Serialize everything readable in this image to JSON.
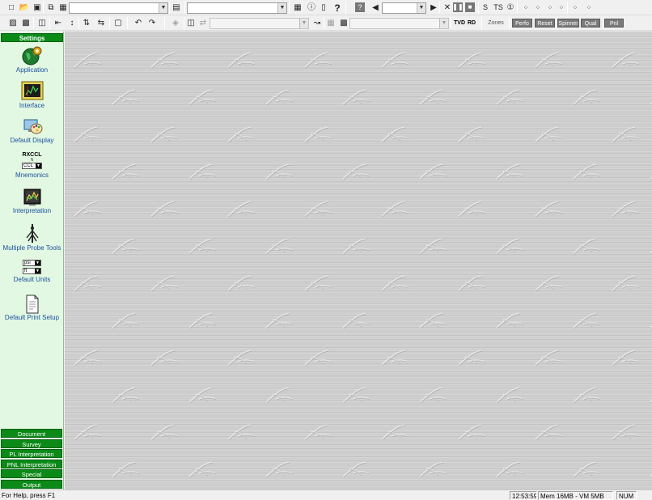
{
  "toolbar1": {
    "icons": [
      "new-file-icon",
      "open-folder-icon",
      "save-icon",
      "copy-icon",
      "paste-icon"
    ],
    "combo1": "",
    "combo2": "",
    "help_icon": "question-icon",
    "combo3": "",
    "s_label": "S",
    "ts_label": "TS",
    "stop_icon": "stop-icon"
  },
  "toolbar2": {
    "combo_left": "",
    "combo_right": "",
    "tvd_label": "TVD",
    "rd_label": "RD",
    "zones_label": "Zones",
    "buttons": [
      "Perfo",
      "Reset",
      "Spinner",
      "Qual",
      "Pnl"
    ]
  },
  "sidebar": {
    "header": "Settings",
    "items": [
      {
        "label": "Application",
        "icon": "globe-gear-icon"
      },
      {
        "label": "Interface",
        "icon": "monitor-chart-icon"
      },
      {
        "label": "Default Display",
        "icon": "display-palette-icon"
      },
      {
        "label": "Mnemonics",
        "icon": "mnemonics-icon"
      },
      {
        "label": "Interpretation",
        "icon": "interpretation-icon"
      },
      {
        "label": "Multiple Probe Tools",
        "icon": "probe-tool-icon"
      },
      {
        "label": "Default Units",
        "icon": "units-icon"
      },
      {
        "label": "Default Print Setup",
        "icon": "print-page-icon"
      }
    ],
    "mnemonics_title": "RXCCL",
    "mnemonics_sub": "N",
    "mnemonics_select": "CCL",
    "units_select_1": "psi",
    "units_select_2": "ft",
    "categories": [
      "Document",
      "Survey",
      "PL Interpretation",
      "PNL Interpretation",
      "Special",
      "Output"
    ]
  },
  "status": {
    "help": "For Help, press F1",
    "time": "12:53:59",
    "mem": "Mem 16MB - VM 5MB",
    "num": "NUM"
  }
}
